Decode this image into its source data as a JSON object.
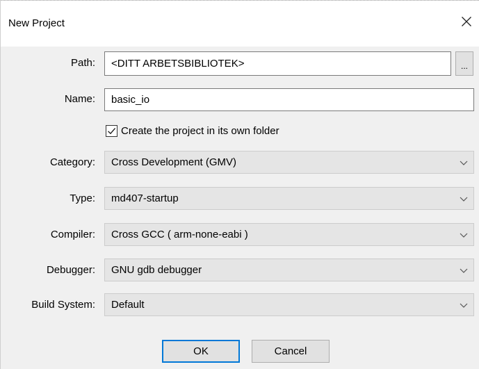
{
  "window": {
    "title": "New Project"
  },
  "form": {
    "path": {
      "label": "Path:",
      "value": "<DITT ARBETSBIBLIOTEK>",
      "browse_label": "..."
    },
    "name": {
      "label": "Name:",
      "value": "basic_io"
    },
    "own_folder": {
      "label": "Create the project in its own folder",
      "checked": true
    },
    "category": {
      "label": "Category:",
      "value": "Cross Development (GMV)"
    },
    "type": {
      "label": "Type:",
      "value": "md407-startup"
    },
    "compiler": {
      "label": "Compiler:",
      "value": "Cross GCC ( arm-none-eabi )"
    },
    "debugger": {
      "label": "Debugger:",
      "value": "GNU gdb debugger"
    },
    "build_system": {
      "label": "Build System:",
      "value": "Default"
    }
  },
  "buttons": {
    "ok": "OK",
    "cancel": "Cancel"
  },
  "icons": {
    "close": "close-icon",
    "checkmark": "checkmark-icon",
    "dropdown": "chevron-down-icon"
  },
  "colors": {
    "dialog_bg": "#f0f0f0",
    "title_bg": "#ffffff",
    "focus_accent": "#0078d7"
  }
}
